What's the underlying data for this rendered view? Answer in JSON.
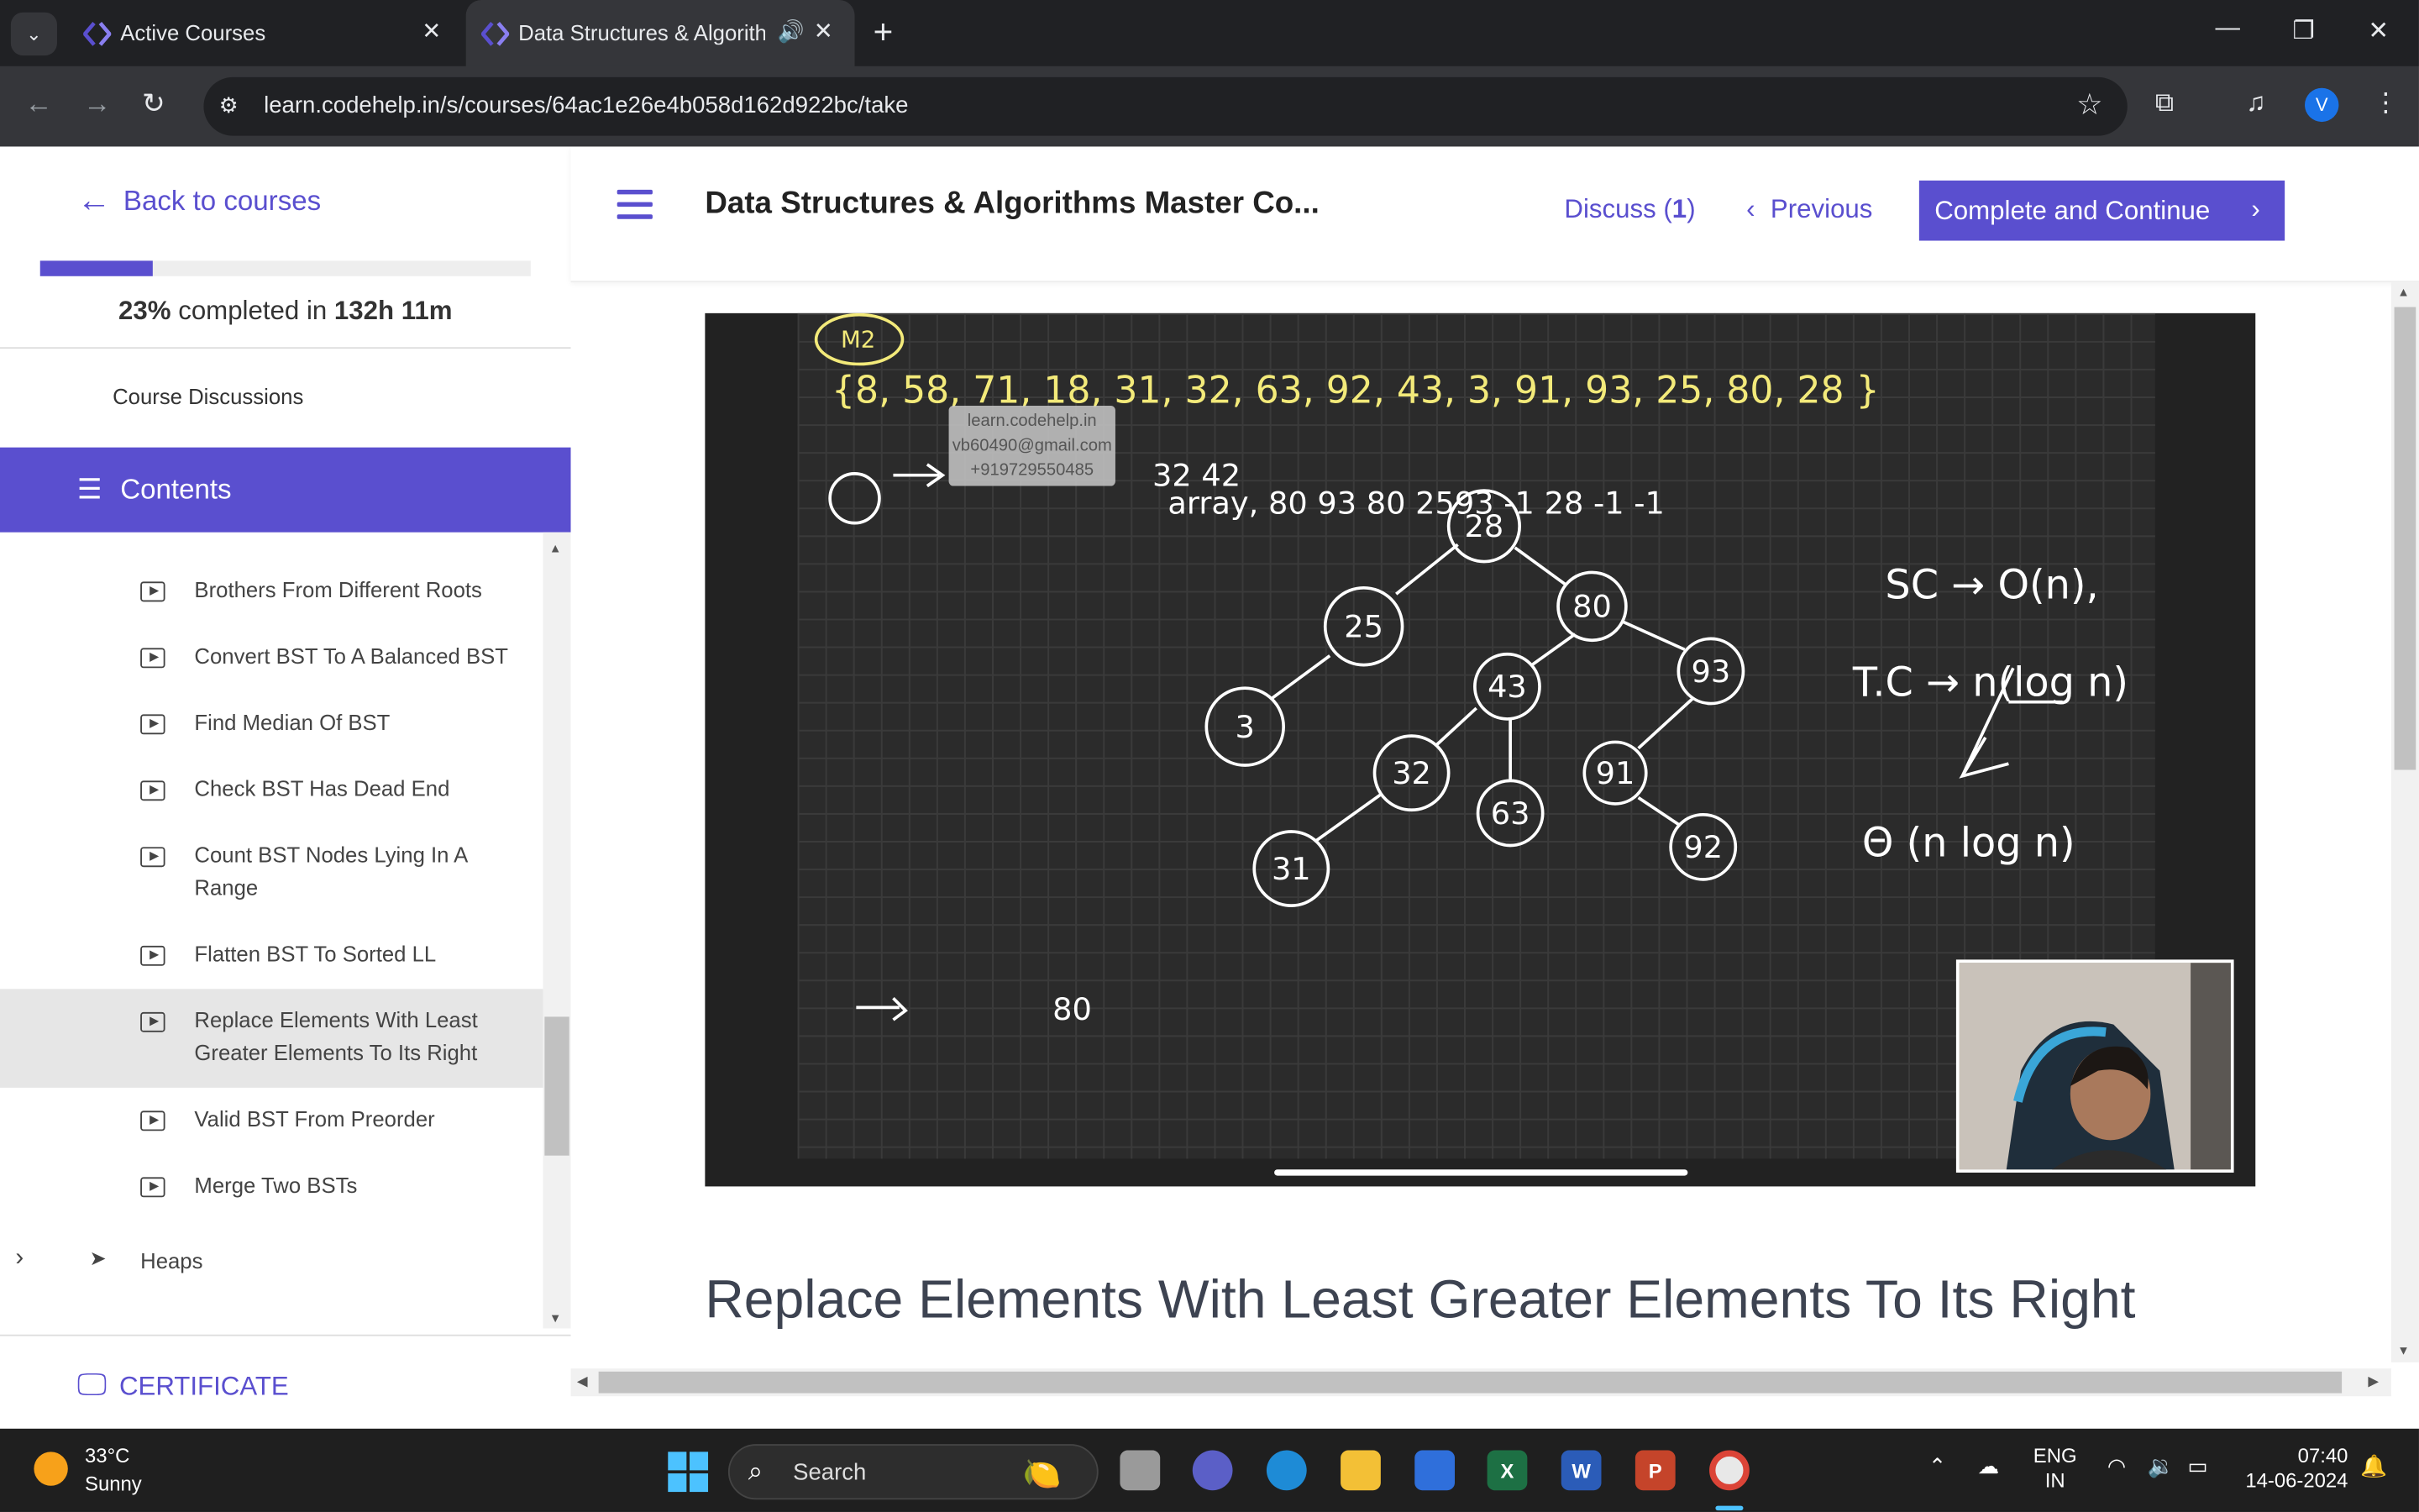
{
  "browser": {
    "tabs": [
      {
        "title": "Active Courses",
        "active": false
      },
      {
        "title": "Data Structures & Algorithm",
        "active": true
      }
    ],
    "url": "learn.codehelp.in/s/courses/64ac1e26e4b058d162d922bc/take",
    "profile_initial": "V"
  },
  "sidebar": {
    "back_label": "Back to courses",
    "progress_fraction": 0.23,
    "progress_percent": "23%",
    "progress_mid": " completed in ",
    "progress_time": "132h 11m",
    "discussions_label": "Course Discussions",
    "contents_label": "Contents",
    "items": [
      {
        "label": "Brothers From Different Roots"
      },
      {
        "label": "Convert BST To A Balanced BST"
      },
      {
        "label": "Find Median Of BST"
      },
      {
        "label": "Check BST Has Dead End"
      },
      {
        "label": "Count BST Nodes Lying In A Range"
      },
      {
        "label": "Flatten BST To Sorted LL"
      },
      {
        "label": "Replace Elements With Least Greater Elements To Its Right"
      },
      {
        "label": "Valid BST From Preorder"
      },
      {
        "label": "Merge Two BSTs"
      }
    ],
    "section_label": "Heaps",
    "certificate_label": "CERTIFICATE"
  },
  "header": {
    "course_title": "Data Structures & Algorithms Master Co...",
    "discuss_label": "Discuss (",
    "discuss_count": "1",
    "discuss_close": ")",
    "previous_label": "Previous",
    "cta_label": "Complete and Continue"
  },
  "video": {
    "watermark": [
      "learn.codehelp.in",
      "vb60490@gmail.com",
      "+919729550485"
    ]
  },
  "lesson": {
    "title": "Replace Elements With Least Greater Elements To Its Right"
  },
  "taskbar": {
    "temperature": "33°C",
    "condition": "Sunny",
    "search_label": "Search",
    "lang_top": "ENG",
    "lang_bottom": "IN",
    "time": "07:40",
    "date": "14-06-2024"
  },
  "colors": {
    "accent": "#5a4fcf",
    "chrome_dark": "#202124",
    "chrome_mid": "#35363a",
    "taskbar": "#1f1f1f"
  }
}
